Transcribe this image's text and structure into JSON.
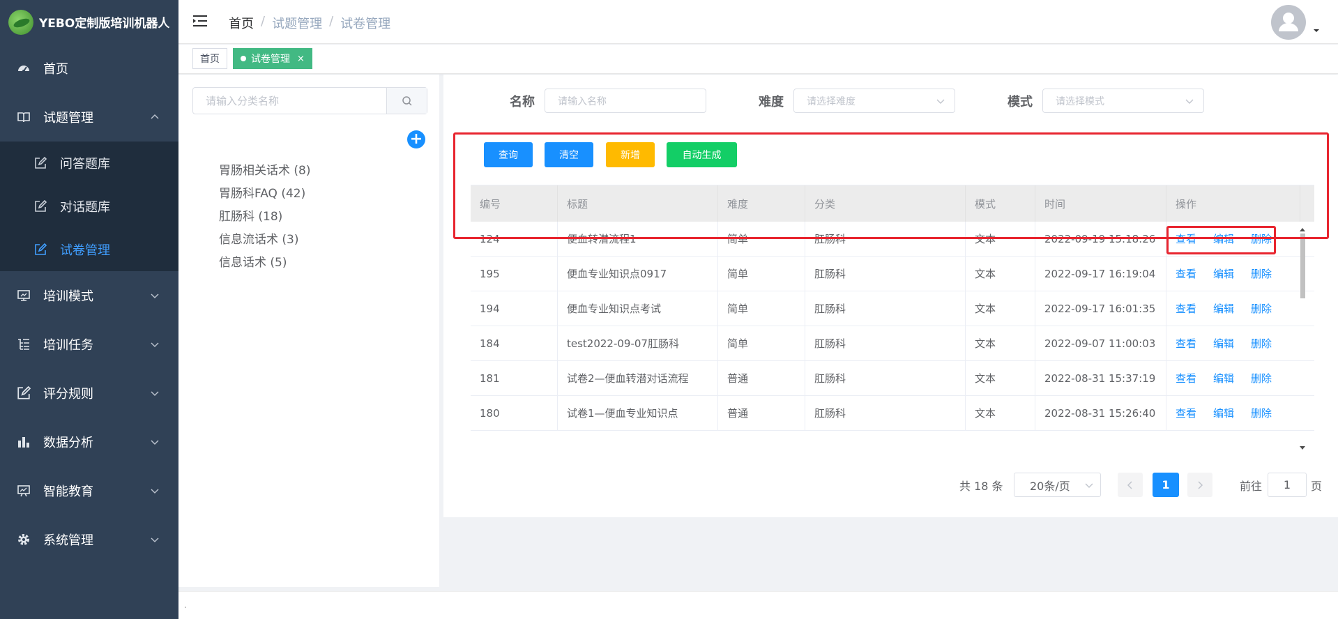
{
  "app": {
    "title": "YEBO定制版培训机器人"
  },
  "sidebar": {
    "items": [
      {
        "label": "首页",
        "icon": "dashboard-icon"
      },
      {
        "label": "试题管理",
        "icon": "book-icon",
        "expanded": true,
        "children": [
          {
            "label": "问答题库",
            "icon": "edit-icon"
          },
          {
            "label": "对话题库",
            "icon": "edit-icon"
          },
          {
            "label": "试卷管理",
            "icon": "edit-icon",
            "active": true
          }
        ]
      },
      {
        "label": "培训模式",
        "icon": "monitor-icon"
      },
      {
        "label": "培训任务",
        "icon": "tree-list-icon"
      },
      {
        "label": "评分规则",
        "icon": "edit-icon"
      },
      {
        "label": "数据分析",
        "icon": "bar-chart-icon"
      },
      {
        "label": "智能教育",
        "icon": "screen-chart-icon"
      },
      {
        "label": "系统管理",
        "icon": "gear-icon"
      }
    ]
  },
  "header": {
    "breadcrumb": [
      "首页",
      "试题管理",
      "试卷管理"
    ],
    "breadcrumb_sep": "/"
  },
  "tags": [
    {
      "label": "首页",
      "active": false
    },
    {
      "label": "试卷管理",
      "active": true,
      "close": "×"
    }
  ],
  "tree": {
    "search_placeholder": "请输入分类名称",
    "add_symbol": "+",
    "items": [
      "胃肠相关话术 (8)",
      "胃肠科FAQ (42)",
      "肛肠科 (18)",
      "信息流话术 (3)",
      "信息话术 (5)"
    ]
  },
  "filters": {
    "name_label": "名称",
    "name_placeholder": "请输入名称",
    "difficulty_label": "难度",
    "difficulty_placeholder": "请选择难度",
    "mode_label": "模式",
    "mode_placeholder": "请选择模式"
  },
  "actions": {
    "query": "查询",
    "clear": "清空",
    "add": "新增",
    "auto": "自动生成"
  },
  "colors": {
    "query": "#1890ff",
    "clear": "#1890ff",
    "add": "#ffba00",
    "auto": "#13ce66",
    "highlight": "#e8252f"
  },
  "table": {
    "columns": [
      "编号",
      "标题",
      "难度",
      "分类",
      "模式",
      "时间",
      "操作"
    ],
    "row_actions": [
      "查看",
      "编辑",
      "删除"
    ],
    "rows": [
      [
        "124",
        "便血转潜流程1",
        "简单",
        "肛肠科",
        "文本",
        "2022-09-19 15:18:26"
      ],
      [
        "195",
        "便血专业知识点0917",
        "简单",
        "肛肠科",
        "文本",
        "2022-09-17 16:19:04"
      ],
      [
        "194",
        "便血专业知识点考试",
        "简单",
        "肛肠科",
        "文本",
        "2022-09-17 16:01:35"
      ],
      [
        "184",
        "test2022-09-07肛肠科",
        "简单",
        "肛肠科",
        "文本",
        "2022-09-07 11:00:03"
      ],
      [
        "181",
        "试卷2—便血转潜对话流程",
        "普通",
        "肛肠科",
        "文本",
        "2022-08-31 15:37:19"
      ],
      [
        "180",
        "试卷1—便血专业知识点",
        "普通",
        "肛肠科",
        "文本",
        "2022-08-31 15:26:40"
      ]
    ]
  },
  "pagination": {
    "total": "共 18 条",
    "page_size": "20条/页",
    "current": "1",
    "goto_label": "前往",
    "goto_value": "1",
    "page_suffix": "页"
  },
  "footer": {
    "text": "."
  }
}
